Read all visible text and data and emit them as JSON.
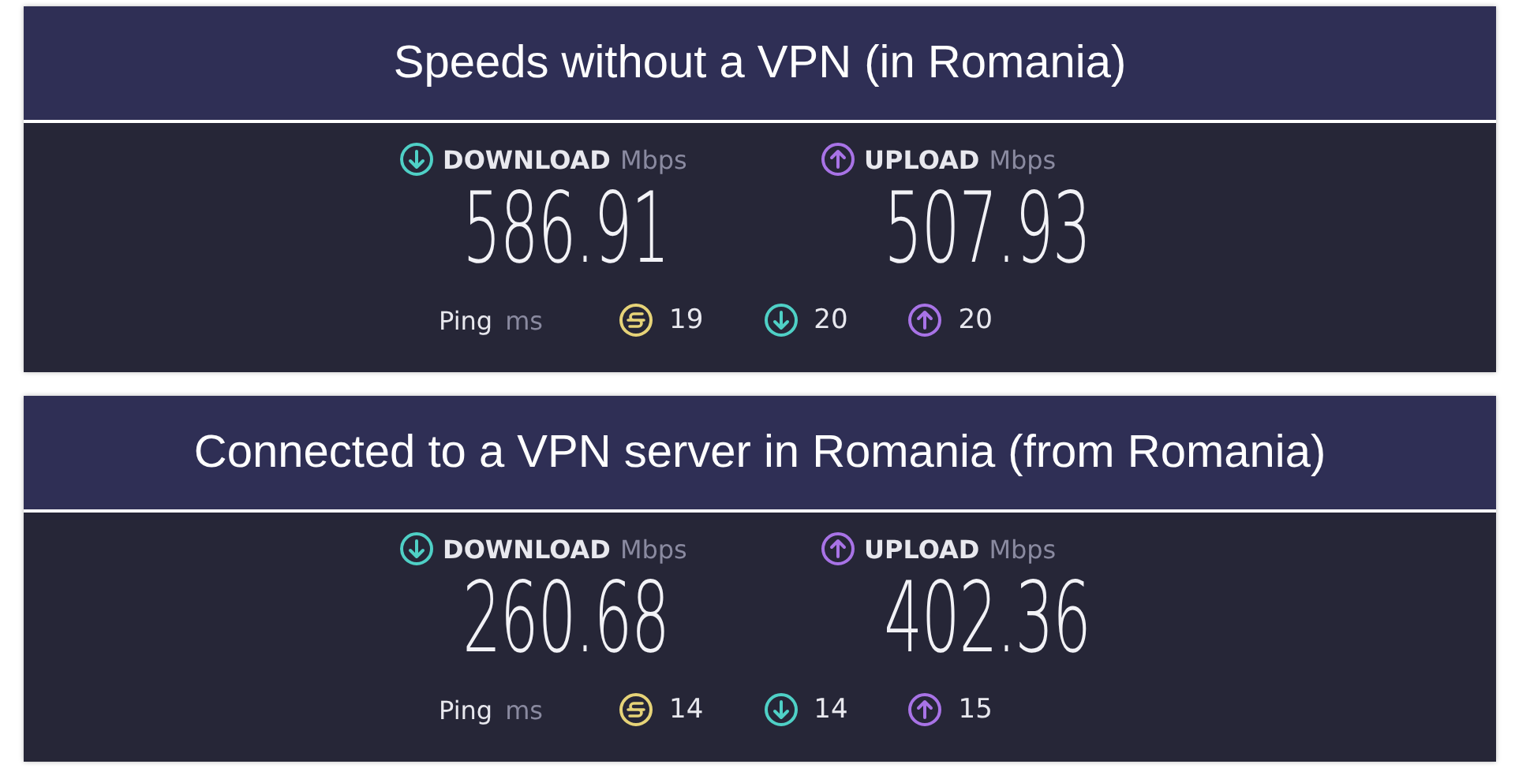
{
  "sections": [
    {
      "title": "Speeds without a VPN (in Romania)",
      "results": [
        {
          "kind": "download",
          "label": "DOWNLOAD",
          "unit": "Mbps",
          "value": "586.91"
        },
        {
          "kind": "upload",
          "label": "UPLOAD",
          "unit": "Mbps",
          "value": "507.93"
        }
      ],
      "ping": {
        "label": "Ping",
        "unit": "ms",
        "readings": [
          {
            "kind": "idle",
            "value": "19"
          },
          {
            "kind": "download",
            "value": "20"
          },
          {
            "kind": "upload",
            "value": "20"
          }
        ]
      }
    },
    {
      "title": "Connected to a VPN server in Romania (from Romania)",
      "results": [
        {
          "kind": "download",
          "label": "DOWNLOAD",
          "unit": "Mbps",
          "value": "260.68"
        },
        {
          "kind": "upload",
          "label": "UPLOAD",
          "unit": "Mbps",
          "value": "402.36"
        }
      ],
      "ping": {
        "label": "Ping",
        "unit": "ms",
        "readings": [
          {
            "kind": "idle",
            "value": "14"
          },
          {
            "kind": "download",
            "value": "14"
          },
          {
            "kind": "upload",
            "value": "15"
          }
        ]
      }
    }
  ]
}
